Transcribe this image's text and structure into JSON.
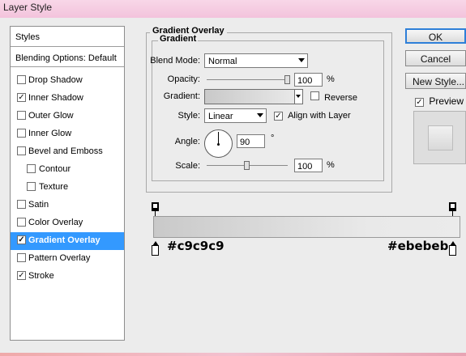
{
  "window": {
    "title": "Layer Style"
  },
  "styles_panel": {
    "header": "Styles",
    "blending_options": "Blending Options: Default",
    "items": [
      {
        "label": "Drop Shadow",
        "checked": false,
        "indent": false,
        "active": false
      },
      {
        "label": "Inner Shadow",
        "checked": true,
        "indent": false,
        "active": false
      },
      {
        "label": "Outer Glow",
        "checked": false,
        "indent": false,
        "active": false
      },
      {
        "label": "Inner Glow",
        "checked": false,
        "indent": false,
        "active": false
      },
      {
        "label": "Bevel and Emboss",
        "checked": false,
        "indent": false,
        "active": false
      },
      {
        "label": "Contour",
        "checked": false,
        "indent": true,
        "active": false
      },
      {
        "label": "Texture",
        "checked": false,
        "indent": true,
        "active": false
      },
      {
        "label": "Satin",
        "checked": false,
        "indent": false,
        "active": false
      },
      {
        "label": "Color Overlay",
        "checked": false,
        "indent": false,
        "active": false
      },
      {
        "label": "Gradient Overlay",
        "checked": true,
        "indent": false,
        "active": true
      },
      {
        "label": "Pattern Overlay",
        "checked": false,
        "indent": false,
        "active": false
      },
      {
        "label": "Stroke",
        "checked": true,
        "indent": false,
        "active": false
      }
    ],
    "check_glyph": "✓"
  },
  "gradient_overlay": {
    "group_title": "Gradient Overlay",
    "subgroup_title": "Gradient",
    "blend_mode_label": "Blend Mode:",
    "blend_mode_value": "Normal",
    "opacity_label": "Opacity:",
    "opacity_value": "100",
    "opacity_unit": "%",
    "opacity_level": 1.0,
    "gradient_label": "Gradient:",
    "reverse_label": "Reverse",
    "reverse_checked": false,
    "style_label": "Style:",
    "style_value": "Linear",
    "align_label": "Align with Layer",
    "align_checked": true,
    "angle_label": "Angle:",
    "angle_value": "90",
    "angle_unit": "°",
    "scale_label": "Scale:",
    "scale_value": "100",
    "scale_unit": "%",
    "scale_level": 0.5
  },
  "gradient_editor": {
    "start_color_label": "#c9c9c9",
    "end_color_label": "#ebebeb"
  },
  "buttons": {
    "ok": "OK",
    "cancel": "Cancel",
    "new_style": "New Style...",
    "preview_label": "Preview",
    "preview_checked": true
  },
  "colors": {
    "selection": "#3399ff",
    "dialog_bg": "#ececec",
    "gradient_start": "#c9c9c9",
    "gradient_end": "#ebebeb"
  }
}
